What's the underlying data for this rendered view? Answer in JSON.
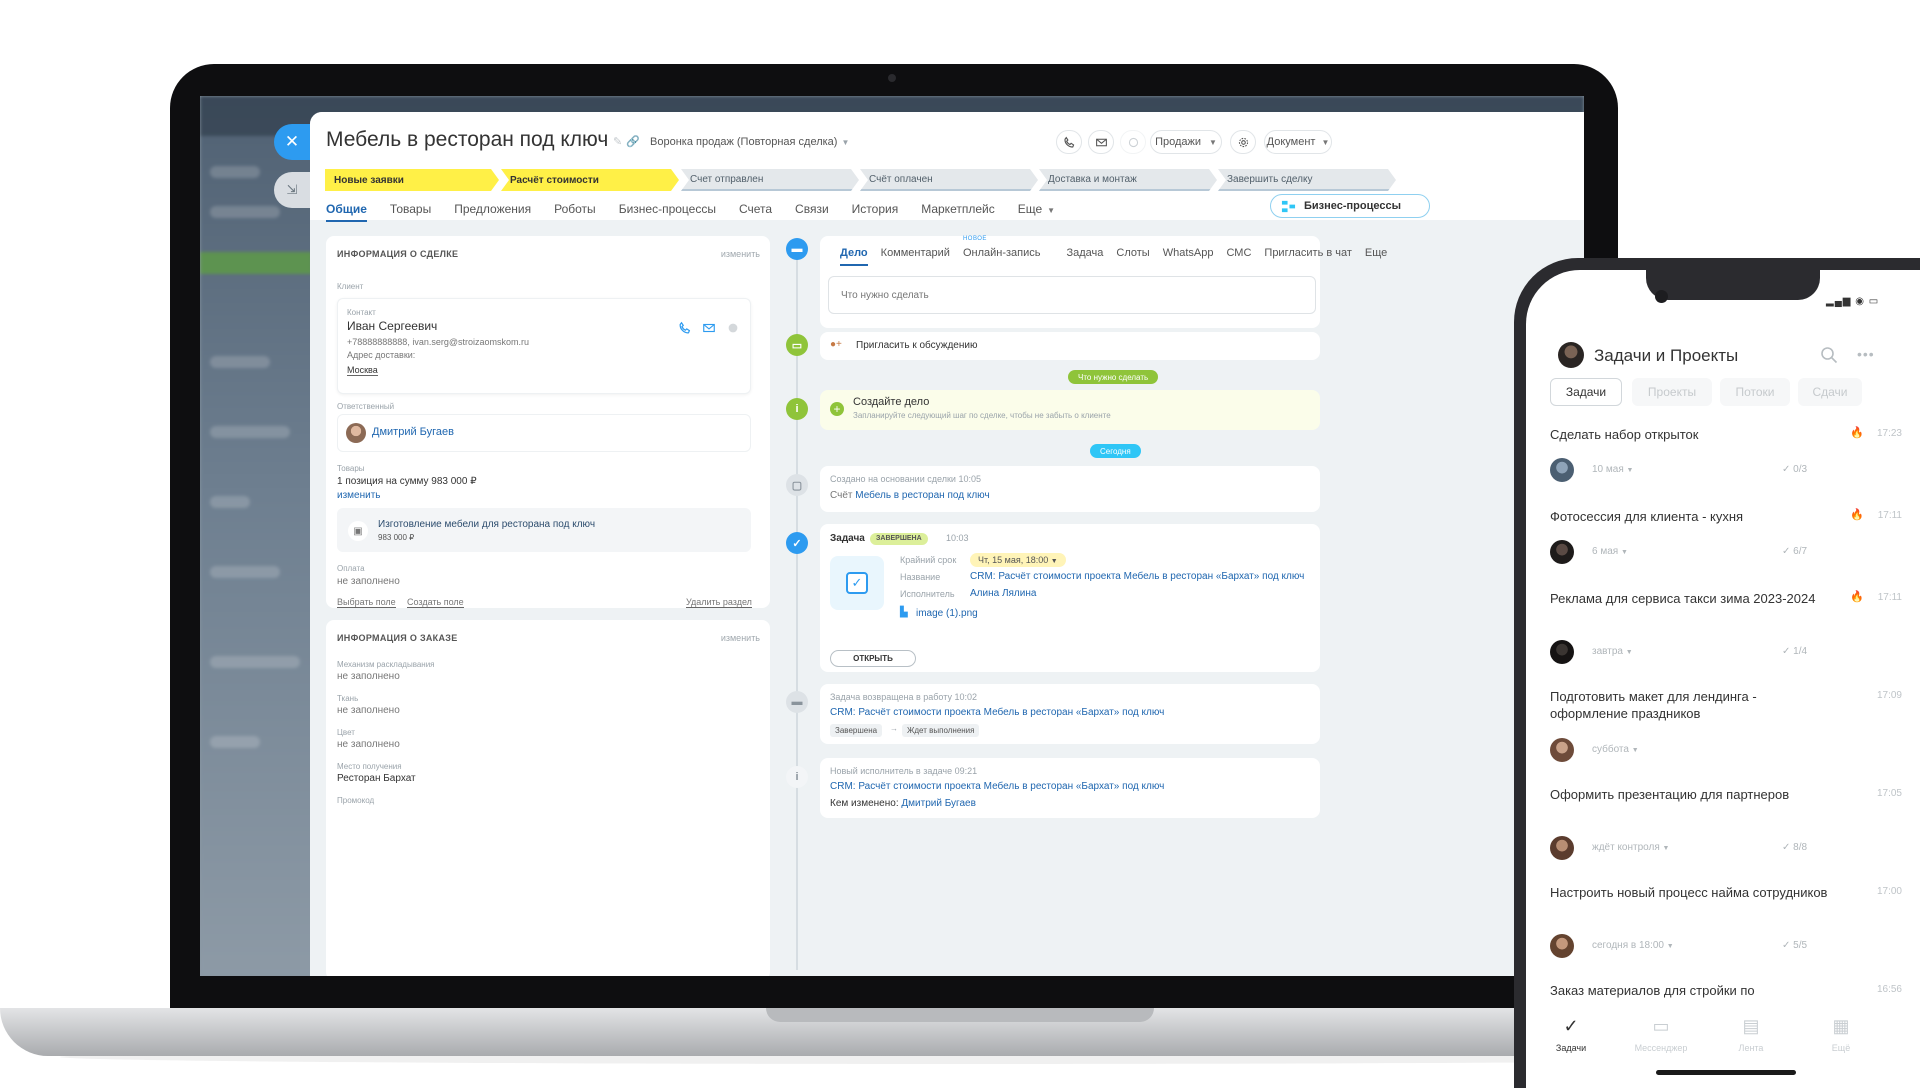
{
  "crm": {
    "title": "Мебель в ресторан под ключ",
    "funnel": "Воронка продаж (Повторная сделка)",
    "toolbar": {
      "sales_label": "Продажи",
      "document_label": "Документ"
    },
    "stages": [
      {
        "label": "Новые заявки",
        "state": "done"
      },
      {
        "label": "Расчёт стоимости",
        "state": "done"
      },
      {
        "label": "Счет отправлен",
        "state": "todo"
      },
      {
        "label": "Счёт оплачен",
        "state": "todo"
      },
      {
        "label": "Доставка и монтаж",
        "state": "todo"
      },
      {
        "label": "Завершить сделку",
        "state": "todo"
      }
    ],
    "tabs": [
      "Общие",
      "Товары",
      "Предложения",
      "Роботы",
      "Бизнес-процессы",
      "Счета",
      "Связи",
      "История",
      "Маркетплейс",
      "Еще"
    ],
    "biz_button": "Бизнес-процессы",
    "deal_info": {
      "heading": "ИНФОРМАЦИЯ О СДЕЛКЕ",
      "edit": "изменить",
      "client_label": "Клиент",
      "contact_label": "Контакт",
      "contact_name": "Иван Сергеевич",
      "contact_details": "+78888888888, ivan.serg@stroizaomskom.ru",
      "address_label": "Адрес доставки:",
      "address_value": "Москва",
      "responsible_label": "Ответственный",
      "responsible_name": "Дмитрий Бугаев",
      "goods_label": "Товары",
      "goods_summary": "1 позиция на сумму 983 000 ₽",
      "goods_edit": "изменить",
      "product_name": "Изготовление мебели для ресторана под ключ",
      "product_price": "983 000 ₽",
      "payment_label": "Оплата",
      "payment_value": "не заполнено",
      "choose_field": "Выбрать поле",
      "create_field": "Создать поле",
      "delete_section": "Удалить раздел"
    },
    "order_info": {
      "heading": "ИНФОРМАЦИЯ О ЗАКАЗЕ",
      "edit": "изменить",
      "fields": [
        {
          "label": "Механизм раскладывания",
          "value": "не заполнено"
        },
        {
          "label": "Ткань",
          "value": "не заполнено"
        },
        {
          "label": "Цвет",
          "value": "не заполнено"
        },
        {
          "label": "Место получения",
          "value": "Ресторан Бархат"
        },
        {
          "label": "Промокод",
          "value": ""
        }
      ]
    },
    "timeline": {
      "tabs": [
        "Дело",
        "Комментарий",
        "Онлайн-запись",
        "Задача",
        "Слоты",
        "WhatsApp",
        "СМС",
        "Пригласить в чат",
        "Еще"
      ],
      "new_badge": "НОВОЕ",
      "todo_placeholder": "Что нужно сделать",
      "invite": "Пригласить к обсуждению",
      "pill_todo": "Что нужно сделать",
      "create_title": "Создайте дело",
      "create_hint": "Запланируйте следующий шаг по сделке, чтобы не забыть о клиенте",
      "pill_today": "Сегодня",
      "created_label": "Создано на основании сделки",
      "created_time": "10:05",
      "invoice_prefix": "Счёт",
      "invoice_link": "Мебель в ресторан под ключ",
      "task_label": "Задача",
      "task_status": "ЗАВЕРШЕНА",
      "task_time": "10:03",
      "deadline_label": "Крайний срок",
      "deadline_value": "Чт, 15 мая, 18:00",
      "name_label": "Название",
      "name_value": "CRM: Расчёт стоимости проекта Мебель в ресторан «Бархат» под ключ",
      "executor_label": "Исполнитель",
      "executor_value": "Алина Лялина",
      "attachment": "image (1).png",
      "open_button": "ОТКРЫТЬ",
      "returned_label": "Задача возвращена в работу",
      "returned_time": "10:02",
      "returned_link": "CRM: Расчёт стоимости проекта Мебель в ресторан «Бархат» под ключ",
      "status_from": "Завершена",
      "status_to": "Ждет выполнения",
      "new_exec_label": "Новый исполнитель в задаче",
      "new_exec_time": "09:21",
      "new_exec_link": "CRM: Расчёт стоимости проекта Мебель в ресторан «Бархат» под ключ",
      "changed_by_label": "Кем изменено:",
      "changed_by_name": "Дмитрий Бугаев"
    }
  },
  "phone": {
    "title": "Задачи и Проекты",
    "tabs": [
      {
        "label": "Задачи",
        "active": true
      },
      {
        "label": "Проекты",
        "active": false
      },
      {
        "label": "Потоки",
        "active": false
      },
      {
        "label": "Сдачи",
        "active": false
      }
    ],
    "tasks": [
      {
        "title": "Сделать набор открыток",
        "time": "17:23",
        "due": "10 мая",
        "checks": "0/3",
        "fire": true
      },
      {
        "title": "Фотосессия для клиента - кухня",
        "time": "17:11",
        "due": "6 мая",
        "checks": "6/7",
        "fire": true
      },
      {
        "title": "Реклама для сервиса такси зима 2023-2024",
        "time": "17:11",
        "due": "завтра",
        "checks": "1/4",
        "fire": true
      },
      {
        "title": "Подготовить макет для лендинга - оформление праздников",
        "time": "17:09",
        "due": "суббота",
        "checks": "",
        "fire": false
      },
      {
        "title": "Оформить презентацию для партнеров",
        "time": "17:05",
        "due": "ждёт контроля",
        "checks": "8/8",
        "fire": false
      },
      {
        "title": "Настроить новый процесс найма сотрудников",
        "time": "17:00",
        "due": "сегодня в 18:00",
        "checks": "5/5",
        "fire": false
      },
      {
        "title": "Заказ материалов для стройки по",
        "time": "16:56",
        "due": "",
        "checks": "",
        "fire": false
      }
    ],
    "nav": [
      {
        "label": "Задачи",
        "icon": "check-circle-icon",
        "active": true
      },
      {
        "label": "Мессенджер",
        "icon": "chat-icon",
        "active": false
      },
      {
        "label": "Лента",
        "icon": "feed-icon",
        "active": false
      },
      {
        "label": "Ещё",
        "icon": "grid-icon",
        "active": false
      }
    ]
  },
  "colors": {
    "accent": "#2067b0",
    "stage_done": "#fff047",
    "timeline_green": "#8fc43a",
    "blue_button": "#2d9bf0"
  }
}
